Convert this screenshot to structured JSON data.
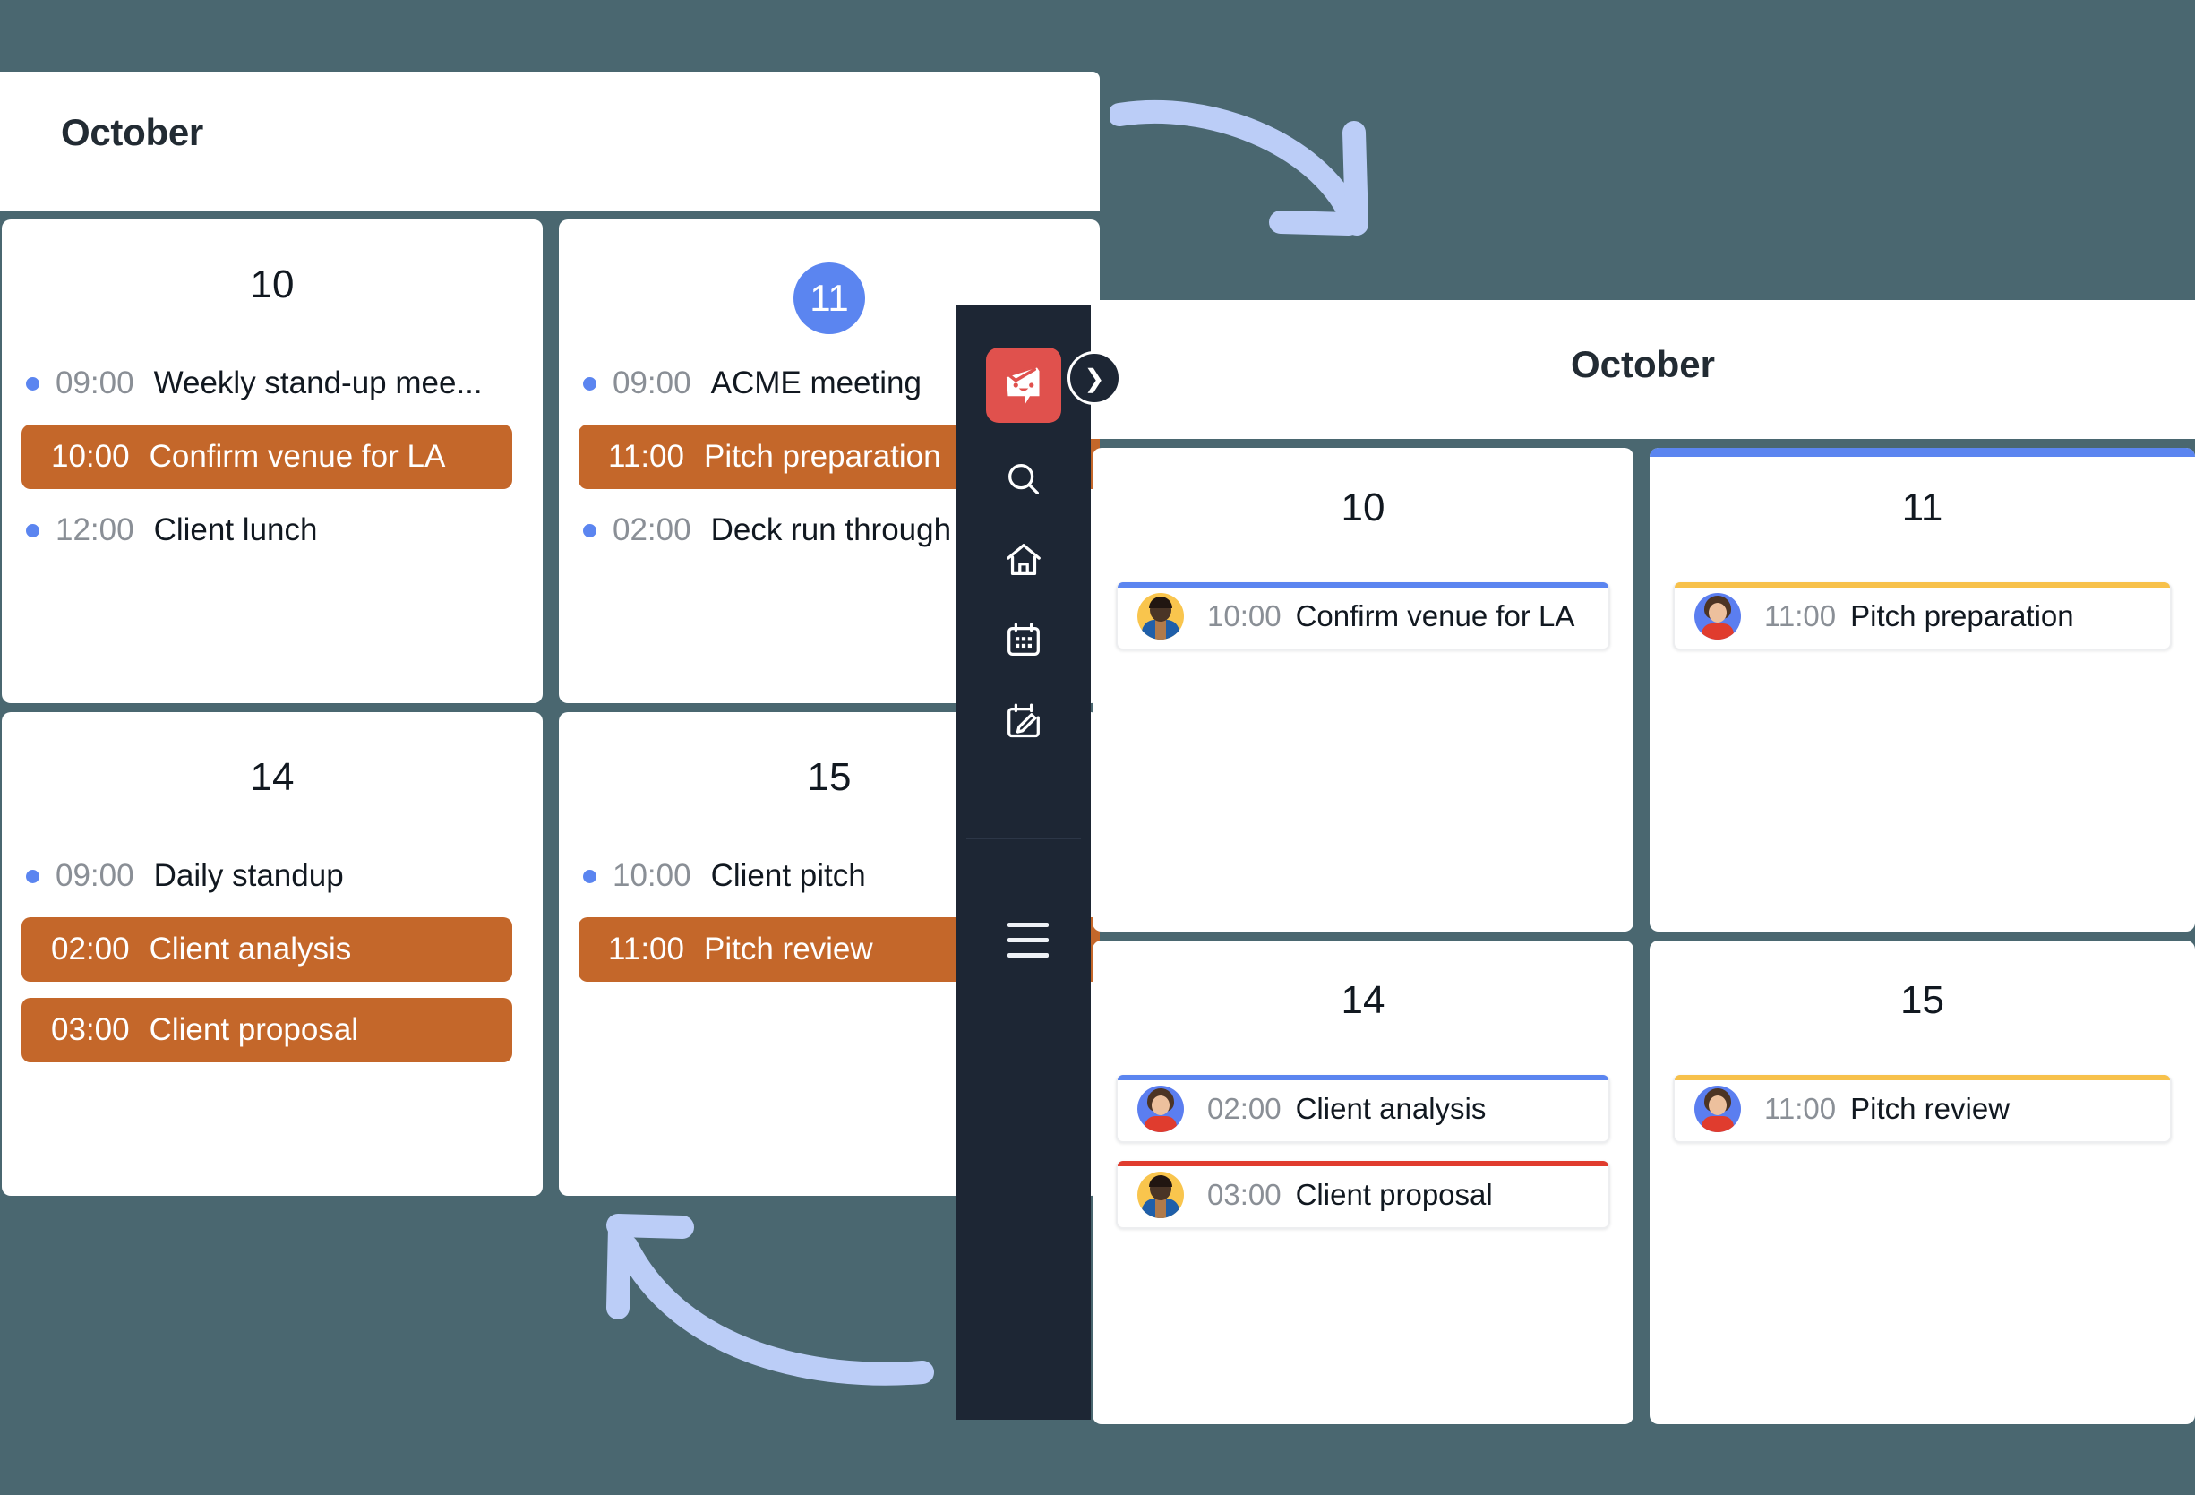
{
  "theme": {
    "background": "#4a6770",
    "sidebar_bg": "#1d2634",
    "logo_bg": "#e0514d",
    "accent_blue": "#5b85f0",
    "highlight_orange": "#c4672a",
    "arrow_blue": "#bbcdf7",
    "event_accent_blue": "#5b85f0",
    "event_accent_yellow": "#f7c14b",
    "event_accent_red": "#e03c2e"
  },
  "left_panel": {
    "header_title": "October",
    "days": [
      {
        "day": "10",
        "selected": false,
        "events": [
          {
            "time": "09:00",
            "name": "Weekly stand-up mee...",
            "highlight": false
          },
          {
            "time": "10:00",
            "name": "Confirm venue for LA",
            "highlight": true
          },
          {
            "time": "12:00",
            "name": "Client lunch",
            "highlight": false
          }
        ]
      },
      {
        "day": "11",
        "selected": true,
        "events": [
          {
            "time": "09:00",
            "name": "ACME meeting",
            "highlight": false
          },
          {
            "time": "11:00",
            "name": "Pitch preparation",
            "highlight": true
          },
          {
            "time": "02:00",
            "name": "Deck run through",
            "highlight": false
          }
        ]
      },
      {
        "day": "14",
        "selected": false,
        "events": [
          {
            "time": "09:00",
            "name": "Daily standup",
            "highlight": false
          },
          {
            "time": "02:00",
            "name": "Client analysis",
            "highlight": true
          },
          {
            "time": "03:00",
            "name": "Client proposal",
            "highlight": true
          }
        ]
      },
      {
        "day": "15",
        "selected": false,
        "events": [
          {
            "time": "10:00",
            "name": "Client pitch",
            "highlight": false
          },
          {
            "time": "11:00",
            "name": "Pitch review",
            "highlight": true
          }
        ]
      }
    ]
  },
  "sidebar": {
    "logo_icon": "app-logo-smiley-icon",
    "items": [
      {
        "icon": "search-icon"
      },
      {
        "icon": "home-icon"
      },
      {
        "icon": "calendar-icon"
      },
      {
        "icon": "calendar-edit-icon"
      }
    ],
    "menu_icon": "hamburger-menu-icon",
    "expand_icon": "chevron-right-icon"
  },
  "right_panel": {
    "header_title": "October",
    "days": [
      {
        "day": "10",
        "card_accent": "",
        "events": [
          {
            "time": "10:00",
            "name": "Confirm venue for LA",
            "accent": "#5b85f0",
            "avatar": "male"
          }
        ]
      },
      {
        "day": "11",
        "card_accent": "#5b85f0",
        "events": [
          {
            "time": "11:00",
            "name": "Pitch preparation",
            "accent": "#f7c14b",
            "avatar": "female"
          }
        ]
      },
      {
        "day": "14",
        "card_accent": "",
        "events": [
          {
            "time": "02:00",
            "name": "Client analysis",
            "accent": "#5b85f0",
            "avatar": "female"
          },
          {
            "time": "03:00",
            "name": "Client proposal",
            "accent": "#e03c2e",
            "avatar": "male"
          }
        ]
      },
      {
        "day": "15",
        "card_accent": "",
        "events": [
          {
            "time": "11:00",
            "name": "Pitch review",
            "accent": "#f7c14b",
            "avatar": "female"
          }
        ]
      }
    ]
  },
  "annotations": {
    "arrow_top": "curved-arrow-pointing-down-right",
    "arrow_bottom": "curved-arrow-pointing-up-left"
  }
}
